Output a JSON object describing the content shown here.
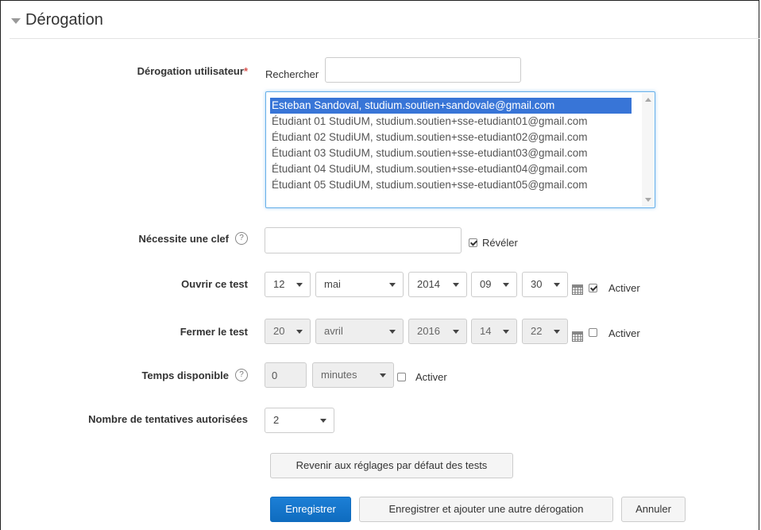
{
  "section": {
    "title": "Dérogation"
  },
  "user_override": {
    "label": "Dérogation utilisateur",
    "required_mark": "*",
    "search_label": "Rechercher",
    "search_value": "",
    "options": [
      {
        "text": "Esteban Sandoval, studium.soutien+sandovale@gmail.com",
        "selected": true
      },
      {
        "text": "Étudiant 01 StudiUM, studium.soutien+sse-etudiant01@gmail.com",
        "selected": false
      },
      {
        "text": "Étudiant 02 StudiUM, studium.soutien+sse-etudiant02@gmail.com",
        "selected": false
      },
      {
        "text": "Étudiant 03 StudiUM, studium.soutien+sse-etudiant03@gmail.com",
        "selected": false
      },
      {
        "text": "Étudiant 04 StudiUM, studium.soutien+sse-etudiant04@gmail.com",
        "selected": false
      },
      {
        "text": "Étudiant 05 StudiUM, studium.soutien+sse-etudiant05@gmail.com",
        "selected": false
      }
    ]
  },
  "password": {
    "label": "Nécessite une clef",
    "help": "?",
    "value": "",
    "reveal_label": "Révéler",
    "reveal_checked": true
  },
  "open_quiz": {
    "label": "Ouvrir ce test",
    "day": "12",
    "month": "mai",
    "year": "2014",
    "hour": "09",
    "minute": "30",
    "enable_label": "Activer",
    "enabled": true
  },
  "close_quiz": {
    "label": "Fermer le test",
    "day": "20",
    "month": "avril",
    "year": "2016",
    "hour": "14",
    "minute": "22",
    "enable_label": "Activer",
    "enabled": false
  },
  "time_limit": {
    "label": "Temps disponible",
    "help": "?",
    "value": "0",
    "unit": "minutes",
    "enable_label": "Activer",
    "enabled": false
  },
  "attempts": {
    "label": "Nombre de tentatives autorisées",
    "value": "2"
  },
  "buttons": {
    "revert": "Revenir aux réglages par défaut des tests",
    "save": "Enregistrer",
    "save_add": "Enregistrer et ajouter une autre dérogation",
    "cancel": "Annuler"
  }
}
